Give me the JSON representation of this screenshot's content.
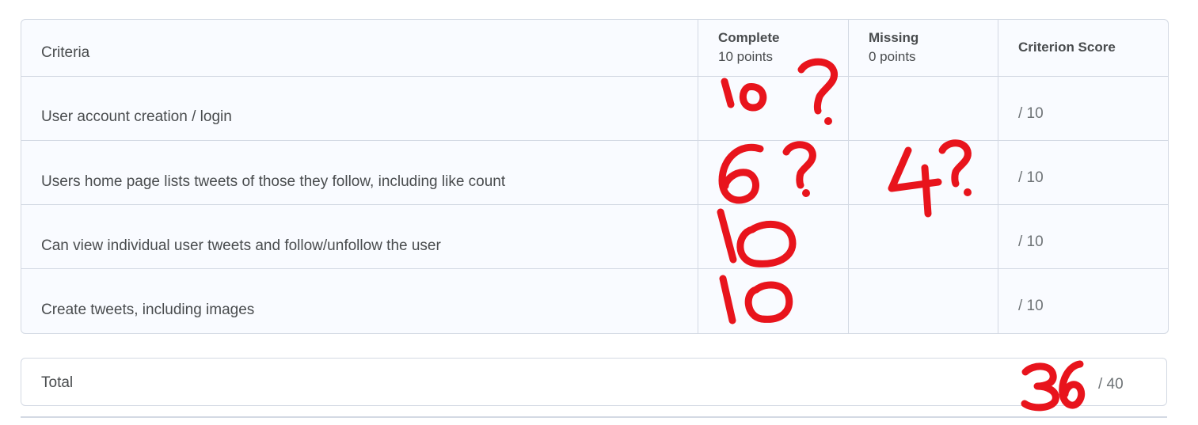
{
  "rubric": {
    "header": {
      "criteria_label": "Criteria",
      "levels": [
        {
          "name": "Complete",
          "points": "10 points"
        },
        {
          "name": "Missing",
          "points": "0 points"
        }
      ],
      "score_label": "Criterion Score"
    },
    "rows": [
      {
        "criterion": "User account creation / login",
        "score": "/ 10"
      },
      {
        "criterion": "Users home page lists tweets of those they follow, including like count",
        "score": "/ 10"
      },
      {
        "criterion": "Can view individual user tweets and follow/unfollow the user",
        "score": "/ 10"
      },
      {
        "criterion": "Create tweets, including images",
        "score": "/ 10"
      }
    ]
  },
  "total": {
    "label": "Total",
    "out_of": "/ 40"
  },
  "annotations": {
    "color": "#e8141c",
    "marks": [
      "10?",
      "6?",
      "4?",
      "10",
      "10",
      "36"
    ]
  }
}
